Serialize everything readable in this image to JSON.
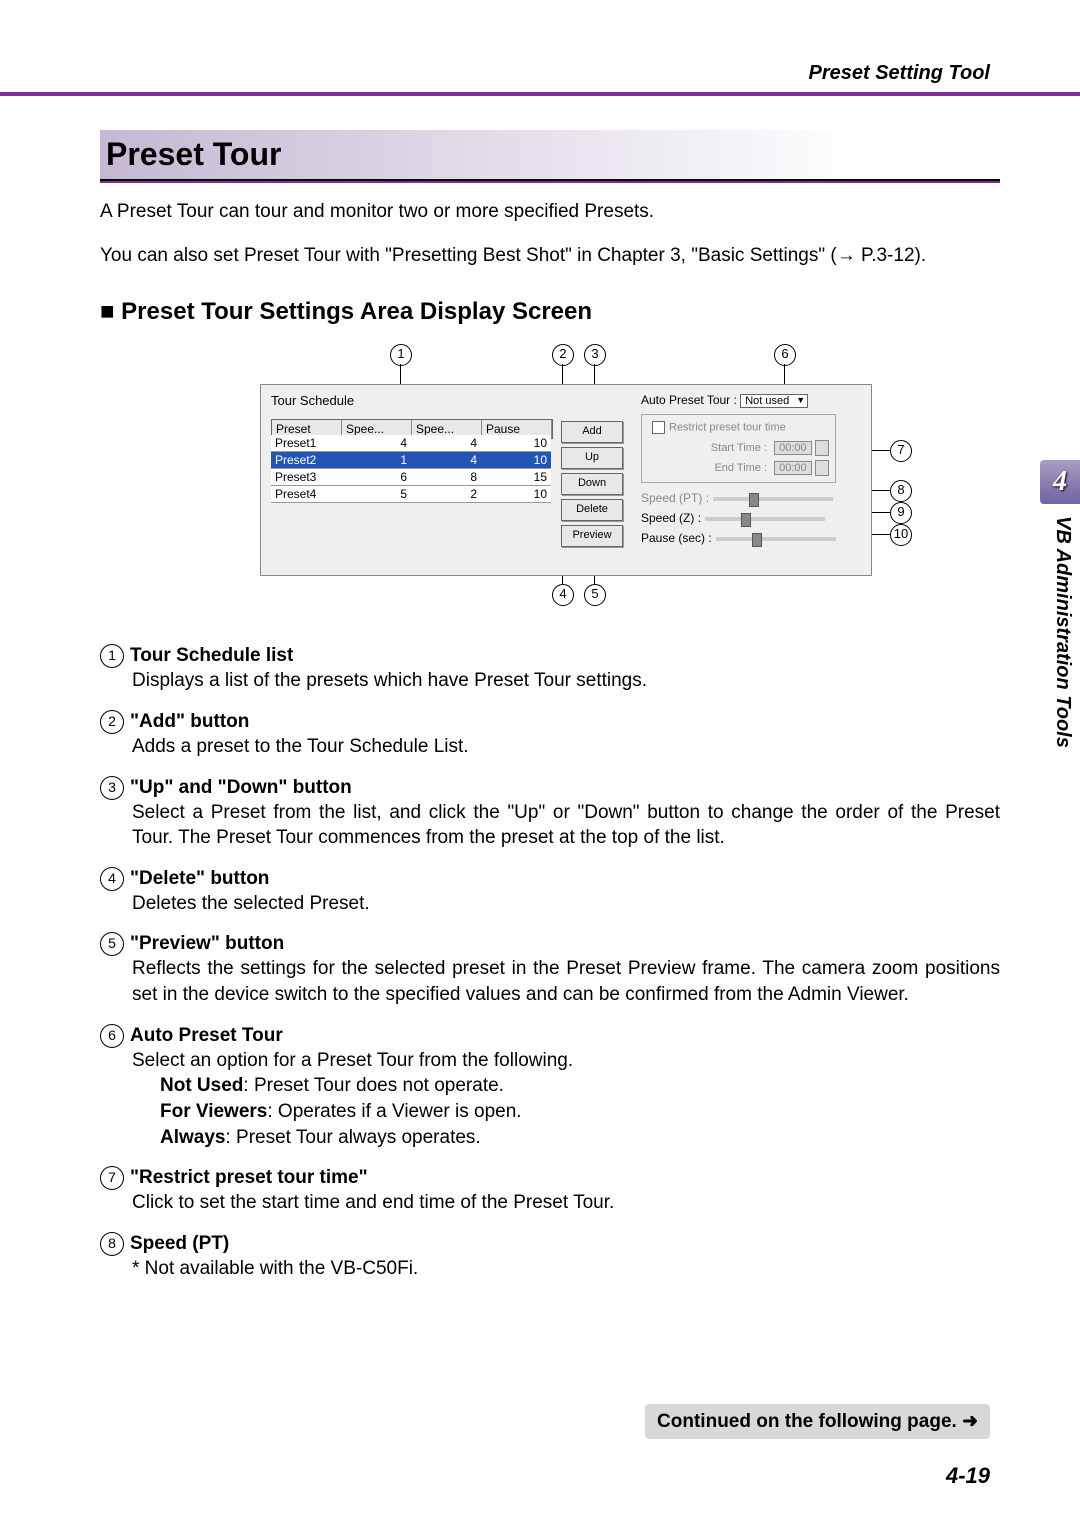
{
  "header": {
    "tool_name": "Preset Setting Tool"
  },
  "title": "Preset Tour",
  "intro1": "A Preset Tour can tour and monitor two or more specified Presets.",
  "intro2": "You can also set Preset Tour with \"Presetting Best Shot\" in Chapter 3, \"Basic Settings\" (→ P.3-12).",
  "subhead_marker": "■",
  "subhead": "Preset Tour Settings Area Display Screen",
  "screenshot": {
    "tour_schedule_label": "Tour Schedule",
    "columns": [
      "Preset",
      "Spee...",
      "Spee...",
      "Pause"
    ],
    "rows": [
      {
        "preset": "Preset1",
        "s1": "4",
        "s2": "4",
        "pause": "10",
        "sel": false
      },
      {
        "preset": "Preset2",
        "s1": "1",
        "s2": "4",
        "pause": "10",
        "sel": true
      },
      {
        "preset": "Preset3",
        "s1": "6",
        "s2": "8",
        "pause": "15",
        "sel": false
      },
      {
        "preset": "Preset4",
        "s1": "5",
        "s2": "2",
        "pause": "10",
        "sel": false
      }
    ],
    "buttons": {
      "add": "Add",
      "up": "Up",
      "down": "Down",
      "delete": "Delete",
      "preview": "Preview"
    },
    "auto_label": "Auto Preset Tour :",
    "auto_value": "Not used",
    "restrict_label": "Restrict preset tour time",
    "start_label": "Start Time :",
    "start_value": "00:00",
    "end_label": "End Time :",
    "end_value": "00:00",
    "speed_pt_label": "Speed (PT) :",
    "speed_z_label": "Speed (Z) :",
    "pause_label": "Pause (sec) :"
  },
  "callout_numbers": {
    "c1": "1",
    "c2": "2",
    "c3": "3",
    "c4": "4",
    "c5": "5",
    "c6": "6",
    "c7": "7",
    "c8": "8",
    "c9": "9",
    "c10": "10"
  },
  "items": [
    {
      "n": "1",
      "head": "Tour Schedule list",
      "body": "Displays a list of the presets which have Preset Tour settings."
    },
    {
      "n": "2",
      "head": "\"Add\" button",
      "body": "Adds a preset to the Tour Schedule List."
    },
    {
      "n": "3",
      "head": "\"Up\" and \"Down\" button",
      "body": "Select a Preset from the list, and click the \"Up\" or \"Down\" button to change the order of the Preset Tour. The Preset Tour commences from the preset at the top of the list."
    },
    {
      "n": "4",
      "head": "\"Delete\" button",
      "body": "Deletes the selected Preset."
    },
    {
      "n": "5",
      "head": "\"Preview\" button",
      "body": "Reflects the settings for the selected preset in the Preset Preview frame. The camera zoom positions set in the device switch to the specified values and can be confirmed from the Admin Viewer."
    },
    {
      "n": "6",
      "head": "Auto Preset Tour",
      "body": "Select an option for a Preset Tour from the following.",
      "subs": [
        {
          "b": "Not Used",
          "t": ": Preset Tour does not operate."
        },
        {
          "b": "For Viewers",
          "t": ": Operates if a Viewer is open."
        },
        {
          "b": "Always",
          "t": ": Preset Tour always operates."
        }
      ]
    },
    {
      "n": "7",
      "head": "\"Restrict preset tour time\"",
      "body": "Click to set the start time and end time of the Preset Tour."
    },
    {
      "n": "8",
      "head": "Speed (PT)",
      "body": "* Not available with the VB-C50Fi."
    }
  ],
  "continued": "Continued on the following page. ➜",
  "page_number": "4-19",
  "side_tab": "4",
  "side_text": "VB Administration Tools"
}
